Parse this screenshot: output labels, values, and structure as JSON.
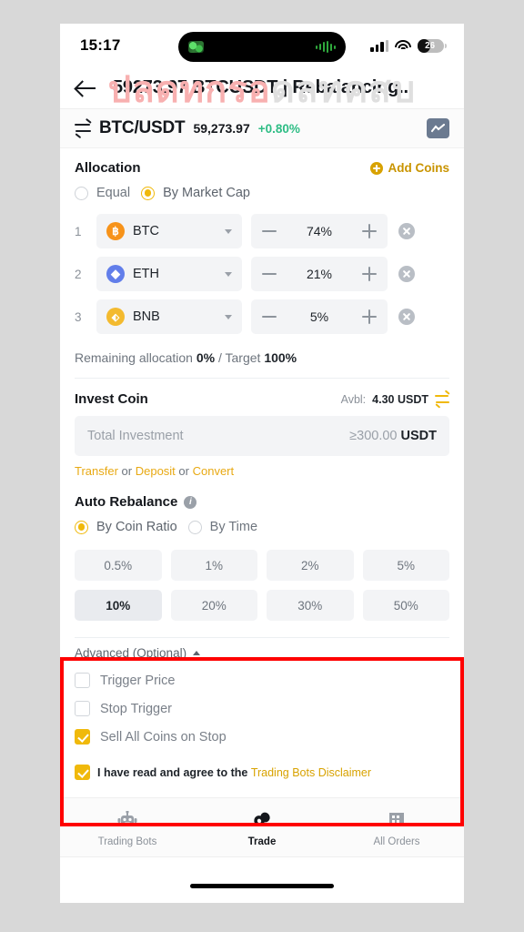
{
  "status_bar": {
    "time": "15:17",
    "battery_level": "26",
    "cellular_icon": "signal-bars-icon",
    "wifi_icon": "wifi-icon",
    "battery_icon": "battery-icon"
  },
  "watermark": {
    "text_pink": "ปลดทกรอ",
    "text_gray": "ดลทคสบ"
  },
  "header": {
    "back_icon": "back-arrow-icon",
    "title": "59273.97 BTCUSDT | Rebalancing..."
  },
  "pair_bar": {
    "swap_icon": "swap-pair-icon",
    "pair": "BTC/USDT",
    "price": "59,273.97",
    "change": "+0.80%",
    "change_color": "#2ebd85",
    "chart_icon": "line-chart-icon"
  },
  "allocation": {
    "title": "Allocation",
    "add_coins_label": "Add Coins",
    "add_coins_icon": "plus-circle-icon",
    "mode_options": [
      {
        "label": "Equal",
        "selected": false
      },
      {
        "label": "By Market Cap",
        "selected": true
      }
    ],
    "coins": [
      {
        "index": "1",
        "symbol": "BTC",
        "glyph": "Ƀ",
        "color": "#F7931A",
        "percent": "74%"
      },
      {
        "index": "2",
        "symbol": "ETH",
        "glyph": "◆",
        "color": "#627EEA",
        "percent": "21%"
      },
      {
        "index": "3",
        "symbol": "BNB",
        "glyph": "⬢",
        "color": "#F3BA2F",
        "percent": "5%"
      }
    ],
    "remaining_prefix": "Remaining allocation ",
    "remaining_value": "0%",
    "remaining_mid": " / Target ",
    "target_value": "100%"
  },
  "invest": {
    "title": "Invest Coin",
    "avbl_label": "Avbl:",
    "avbl_value": "4.30 USDT",
    "swap_icon": "transfer-swap-icon",
    "input_placeholder": "Total Investment",
    "min_value": "≥300.00",
    "unit": "USDT",
    "link_transfer": "Transfer",
    "link_deposit": "Deposit",
    "link_convert": "Convert",
    "or_text": " or "
  },
  "auto_rebalance": {
    "title": "Auto Rebalance",
    "info_icon": "info-icon",
    "mode_options": [
      {
        "label": "By Coin Ratio",
        "selected": true
      },
      {
        "label": "By Time",
        "selected": false
      }
    ],
    "chips": [
      {
        "label": "0.5%",
        "selected": false
      },
      {
        "label": "1%",
        "selected": false
      },
      {
        "label": "2%",
        "selected": false
      },
      {
        "label": "5%",
        "selected": false
      },
      {
        "label": "10%",
        "selected": true
      },
      {
        "label": "20%",
        "selected": false
      },
      {
        "label": "30%",
        "selected": false
      },
      {
        "label": "50%",
        "selected": false
      }
    ]
  },
  "advanced": {
    "toggle_label": "Advanced (Optional)",
    "chevron_icon": "chevron-up-icon",
    "checkboxes": [
      {
        "label": "Trigger Price",
        "checked": false
      },
      {
        "label": "Stop Trigger",
        "checked": false
      },
      {
        "label": "Sell All Coins on Stop",
        "checked": true
      }
    ],
    "agree": {
      "checked": true,
      "text": "I have read and agree to the ",
      "link": "Trading Bots Disclaimer"
    },
    "highlight_color": "#ff0000"
  },
  "bottom_nav": [
    {
      "label": "Trading Bots",
      "icon": "robot-icon",
      "active": false
    },
    {
      "label": "Trade",
      "icon": "coins-icon",
      "active": true
    },
    {
      "label": "All Orders",
      "icon": "orders-icon",
      "active": false
    }
  ]
}
